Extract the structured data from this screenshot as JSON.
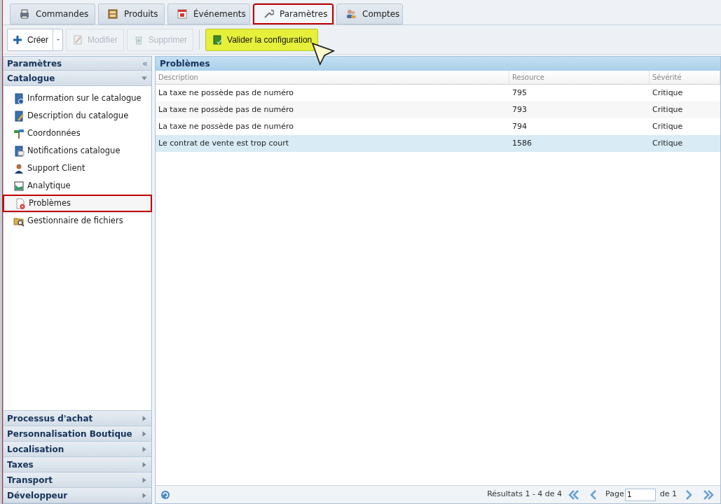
{
  "tabs": [
    {
      "label": "Commandes",
      "selected": false
    },
    {
      "label": "Produits",
      "selected": false
    },
    {
      "label": "Événements",
      "selected": false
    },
    {
      "label": "Paramètres",
      "selected": true
    },
    {
      "label": "Comptes",
      "selected": false
    }
  ],
  "toolbar": [
    {
      "kind": "split",
      "label": "Créer",
      "disabled": false,
      "highlighted": false
    },
    {
      "kind": "button",
      "label": "Modifier",
      "disabled": true,
      "highlighted": false
    },
    {
      "kind": "button",
      "label": "Supprimer",
      "disabled": true,
      "highlighted": false
    },
    {
      "kind": "button",
      "label": "Valider la configuration",
      "disabled": false,
      "highlighted": true
    }
  ],
  "sidebar": {
    "title": "Paramètres",
    "collapse": "«",
    "sections": [
      {
        "label": "Catalogue",
        "expanded": true,
        "items": [
          {
            "label": "Information sur le catalogue",
            "selected": false
          },
          {
            "label": "Description du catalogue",
            "selected": false
          },
          {
            "label": "Coordonnées",
            "selected": false
          },
          {
            "label": "Notifications catalogue",
            "selected": false
          },
          {
            "label": "Support Client",
            "selected": false
          },
          {
            "label": "Analytique",
            "selected": false
          },
          {
            "label": "Problèmes",
            "selected": true
          },
          {
            "label": "Gestionnaire de fichiers",
            "selected": false
          }
        ]
      },
      {
        "label": "Processus d'achat",
        "expanded": false
      },
      {
        "label": "Personnalisation Boutique",
        "expanded": false
      },
      {
        "label": "Localisation",
        "expanded": false
      },
      {
        "label": "Taxes",
        "expanded": false
      },
      {
        "label": "Transport",
        "expanded": false
      },
      {
        "label": "Développeur",
        "expanded": false
      }
    ]
  },
  "panel": {
    "title": "Problèmes",
    "table": {
      "columns": [
        "Description",
        "Resource",
        "Sévérité"
      ],
      "rows": [
        {
          "cells": [
            "La taxe ne possède pas de numéro",
            "795",
            "Critique"
          ],
          "selected": false
        },
        {
          "cells": [
            "La taxe ne possède pas de numéro",
            "793",
            "Critique"
          ],
          "selected": false
        },
        {
          "cells": [
            "La taxe ne possède pas de numéro",
            "794",
            "Critique"
          ],
          "selected": false
        },
        {
          "cells": [
            "Le contrat de vente est trop court",
            "1586",
            "Critique"
          ],
          "selected": true
        }
      ]
    },
    "pager": {
      "results": "Résultats 1 - 4 de 4",
      "page_label": "Page",
      "page": "1",
      "of": "de 1"
    }
  }
}
